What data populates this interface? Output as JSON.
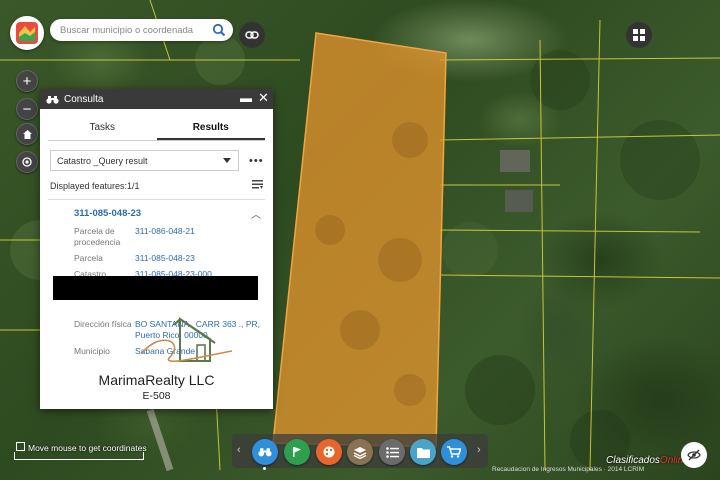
{
  "search": {
    "placeholder": "Buscar municipio o coordenada"
  },
  "panel": {
    "title": "Consulta",
    "tabs": [
      {
        "label": "Tasks",
        "active": false
      },
      {
        "label": "Results",
        "active": true
      }
    ],
    "query_select": "Catastro _Query result",
    "more": "•••",
    "displayed_features": "Displayed features:1/1",
    "result": {
      "id": "311-085-048-23",
      "attributes": [
        {
          "label": "Parcela de procedencia",
          "value": "311-086-048-21"
        },
        {
          "label": "Parcela",
          "value": "311-085-048-23"
        },
        {
          "label": "Catastro",
          "value": "311-085-048-23-000"
        },
        {
          "label": "Dirección física",
          "value": "BO SANTANA , CARR 363 ., PR, Puerto Rico, 00000"
        },
        {
          "label": "Municipio",
          "value": "Sabana Grande"
        }
      ]
    },
    "brand": {
      "name": "MarimaRealty LLC",
      "license": "E-508"
    }
  },
  "map": {
    "coordinates_hint": "Move mouse to get coordinates",
    "attribution": "Recaudacion de Ingresos Municipales · 2014 LCRIM",
    "parcel_fill": "#e8962e",
    "parcel_stroke": "#f0a640",
    "boundary_color": "#d7d23a"
  },
  "watermark": {
    "text_main": "Clasificados",
    "text_accent": "Online"
  },
  "toolbar": {
    "tools": [
      {
        "icon": "binoculars-icon",
        "color": "#2f8fd8"
      },
      {
        "icon": "flag-icon",
        "color": "#2e9e4f"
      },
      {
        "icon": "palette-icon",
        "color": "#e8662e"
      },
      {
        "icon": "layers-icon",
        "color": "#8a7355"
      },
      {
        "icon": "list-icon",
        "color": "#6b6b6b"
      },
      {
        "icon": "folder-icon",
        "color": "#4aa3c9"
      },
      {
        "icon": "cart-icon",
        "color": "#2f8fd8"
      }
    ]
  }
}
